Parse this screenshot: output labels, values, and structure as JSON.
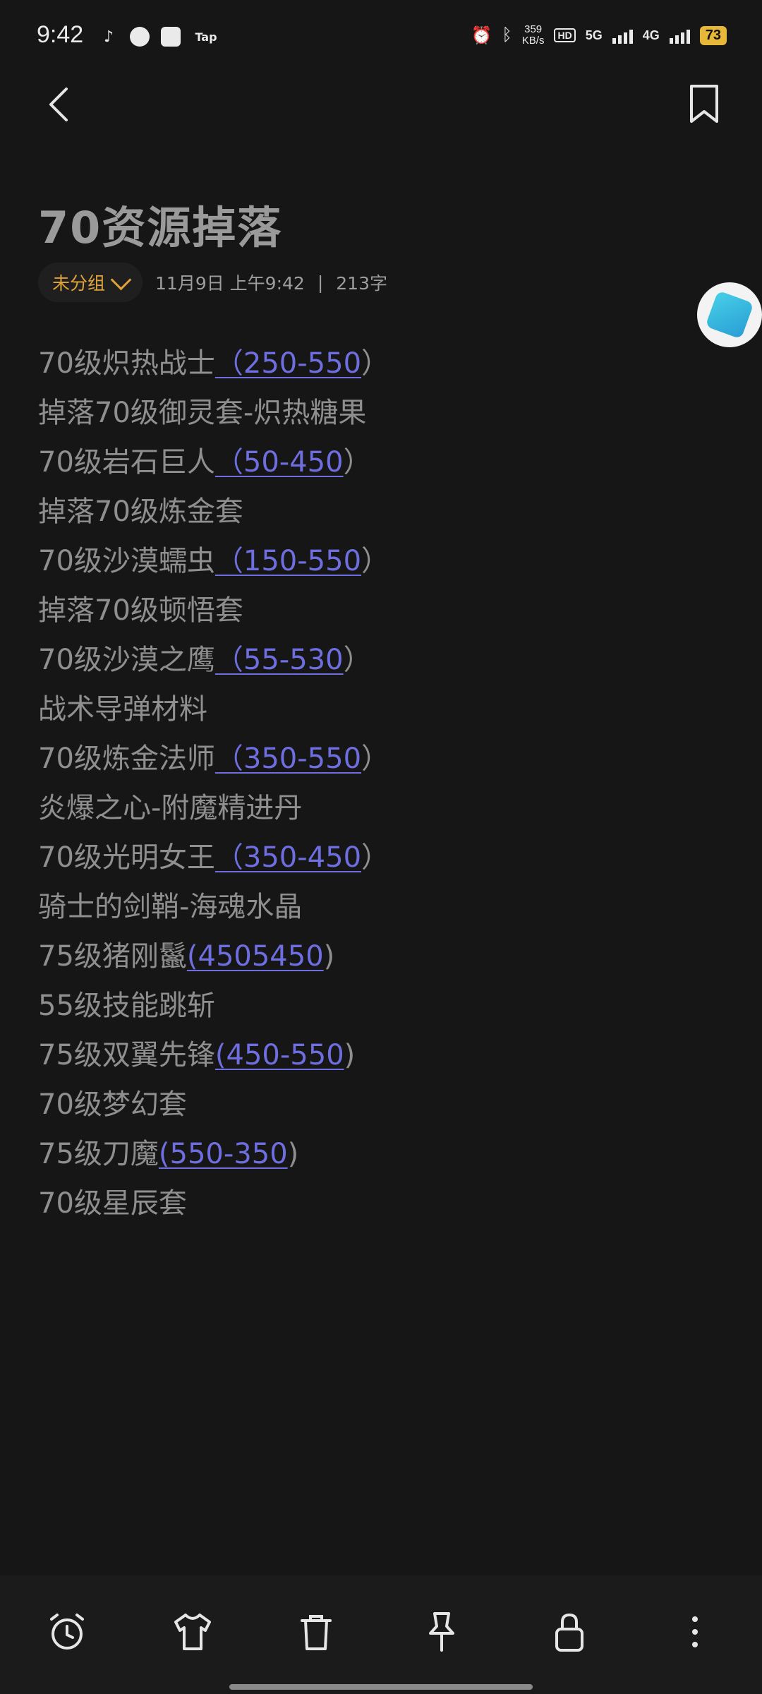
{
  "status_bar": {
    "time": "9:42",
    "speed_top": "359",
    "speed_bottom": "KB/s",
    "net1": "5G",
    "net2": "4G",
    "battery": "73",
    "tap_label": "Tap"
  },
  "note": {
    "title": "70资源掉落",
    "group": "未分组",
    "date": "11月9日 上午9:42",
    "separator": "|",
    "count": "213字",
    "lines": [
      {
        "text": "70级炽热战士",
        "link": "（250-550",
        "tail": "）"
      },
      {
        "text": "掉落70级御灵套-炽热糖果",
        "link": "",
        "tail": ""
      },
      {
        "text": "70级岩石巨人",
        "link": "（50-450",
        "tail": "）"
      },
      {
        "text": "掉落70级炼金套",
        "link": "",
        "tail": ""
      },
      {
        "text": "70级沙漠蠕虫",
        "link": "（150-550",
        "tail": "）"
      },
      {
        "text": "掉落70级顿悟套",
        "link": "",
        "tail": ""
      },
      {
        "text": "70级沙漠之鹰",
        "link": "（55-530",
        "tail": "）"
      },
      {
        "text": "战术导弹材料",
        "link": "",
        "tail": ""
      },
      {
        "text": "70级炼金法师",
        "link": "（350-550",
        "tail": "）"
      },
      {
        "text": "炎爆之心-附魔精进丹",
        "link": "",
        "tail": ""
      },
      {
        "text": "70级光明女王",
        "link": "（350-450",
        "tail": "）"
      },
      {
        "text": "骑士的剑鞘-海魂水晶",
        "link": "",
        "tail": ""
      },
      {
        "text": "75级猪刚鬣",
        "link": "(4505450",
        "tail": ")"
      },
      {
        "text": "55级技能跳斩",
        "link": "",
        "tail": ""
      },
      {
        "text": "75级双翼先锋",
        "link": "(450-550",
        "tail": ")"
      },
      {
        "text": "70级梦幻套",
        "link": "",
        "tail": ""
      },
      {
        "text": "75级刀魔",
        "link": "(550-350",
        "tail": ")"
      },
      {
        "text": "70级星辰套",
        "link": "",
        "tail": ""
      }
    ]
  },
  "colors": {
    "background": "#161616",
    "link": "#6e6ee0",
    "accent": "#e0a33a"
  },
  "toolbar": {
    "icons": [
      "alarm-icon",
      "shirt-icon",
      "trash-icon",
      "pin-icon",
      "lock-icon",
      "more-icon"
    ]
  }
}
